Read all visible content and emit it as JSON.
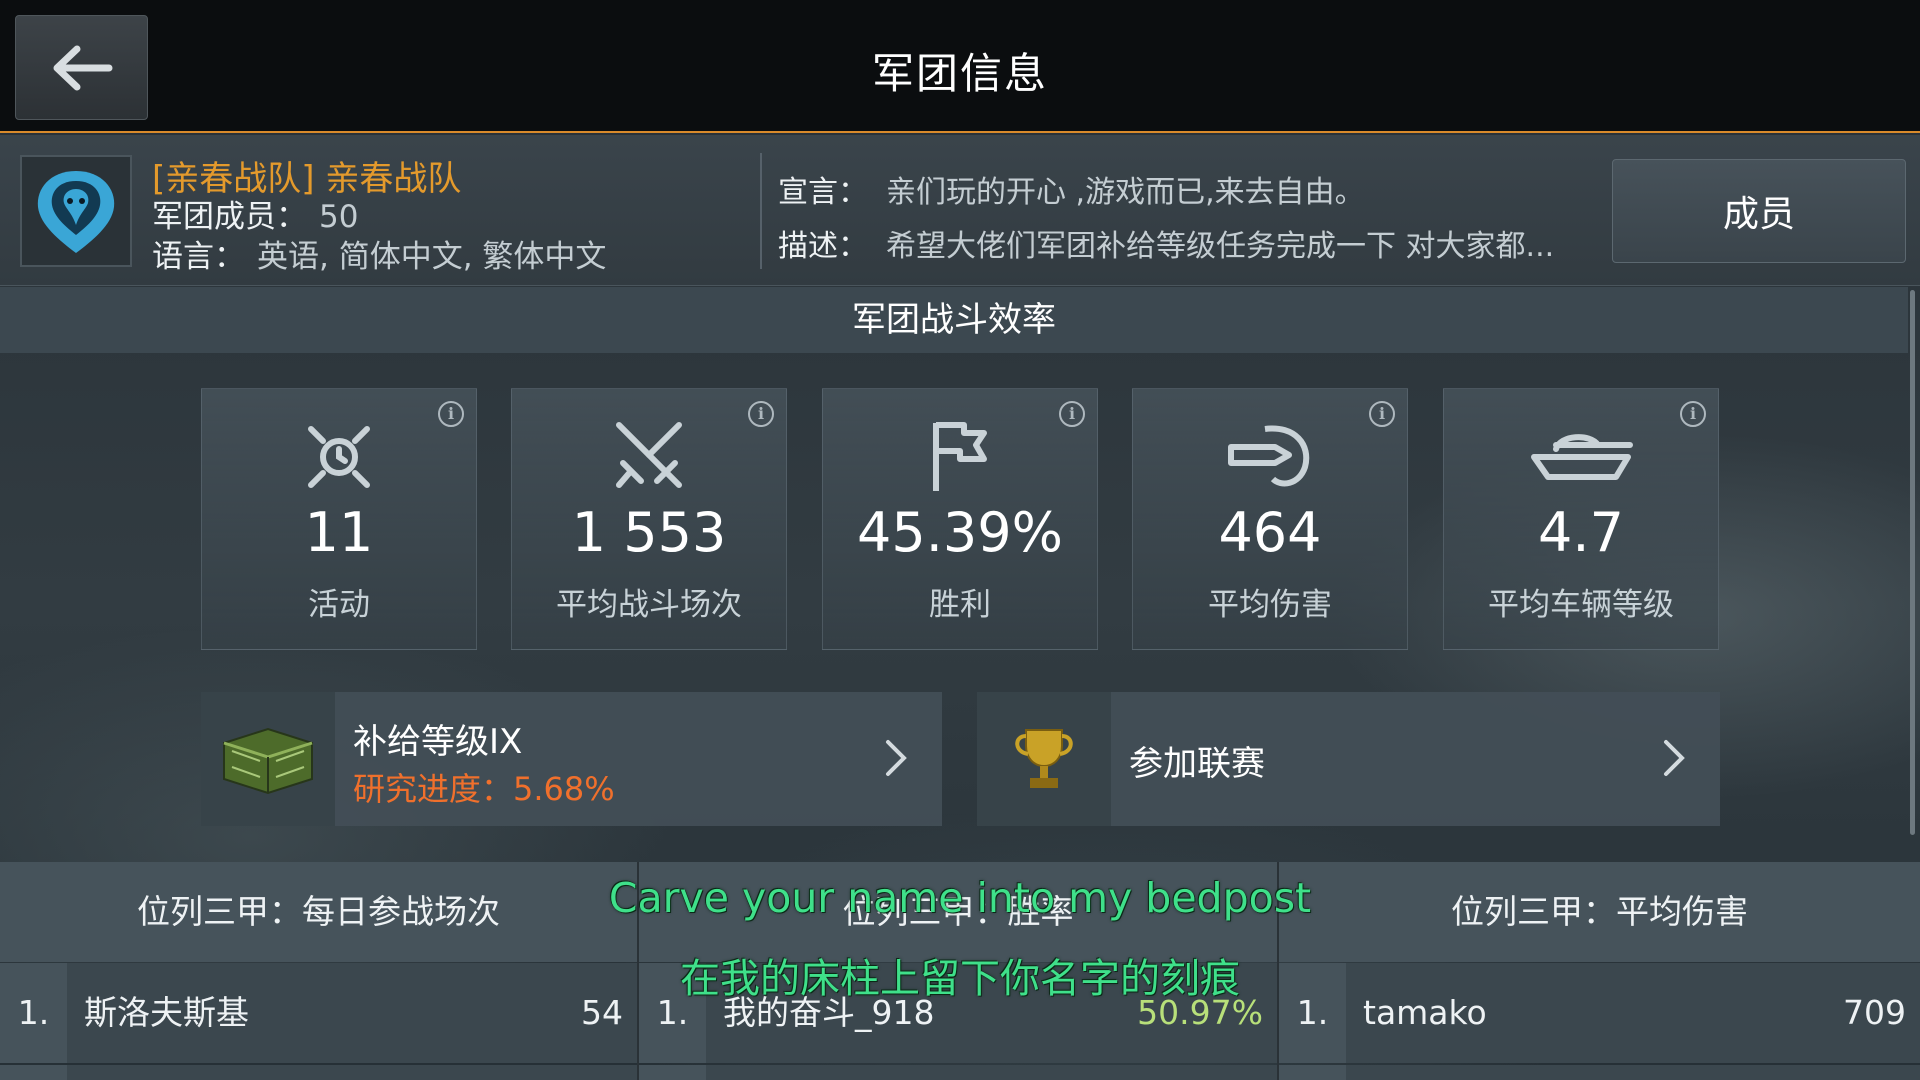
{
  "header": {
    "title": "军团信息"
  },
  "clan": {
    "name": "[亲春战队] 亲春战队",
    "members_label": "军团成员：",
    "members_value": "50",
    "language_label": "语言：",
    "language_value": "英语, 简体中文, 繁体中文",
    "motto_label": "宣言：",
    "motto_value": "亲们玩的开心 ,游戏而已,来去自由。",
    "description_label": "描述：",
    "description_value": "希望大佬们军团补给等级任务完成一下 对大家都...",
    "members_button": "成员"
  },
  "efficiency": {
    "title": "军团战斗效率",
    "stats": [
      {
        "value": "11",
        "label": "活动",
        "icon": "activity-icon"
      },
      {
        "value": "1 553",
        "label": "平均战斗场次",
        "icon": "crossed-swords-icon"
      },
      {
        "value": "45.39%",
        "label": "胜利",
        "icon": "flag-icon"
      },
      {
        "value": "464",
        "label": "平均伤害",
        "icon": "shell-damage-icon"
      },
      {
        "value": "4.7",
        "label": "平均车辆等级",
        "icon": "tank-icon"
      }
    ]
  },
  "supply": {
    "title": "补给等级IX",
    "progress_label": "研究进度：",
    "progress_value": "5.68%"
  },
  "league": {
    "title": "参加联赛"
  },
  "leaderboards": [
    {
      "title": "位列三甲：每日参战场次",
      "rank": "1.",
      "name": "斯洛夫斯基",
      "score": "54"
    },
    {
      "title": "位列三甲：胜率",
      "rank": "1.",
      "name": "我的奋斗_918",
      "score": "50.97%"
    },
    {
      "title": "位列三甲：平均伤害",
      "rank": "1.",
      "name": "tamako",
      "score": "709"
    }
  ],
  "subtitles": {
    "english": "Carve your name into my bedpost",
    "chinese": "在我的床柱上留下你名字的刻痕"
  },
  "colors": {
    "accent_orange": "#e49a2c",
    "progress_orange": "#f0702c",
    "winrate_green": "#b8e07a",
    "subtitle_green": "#3fe08a"
  }
}
